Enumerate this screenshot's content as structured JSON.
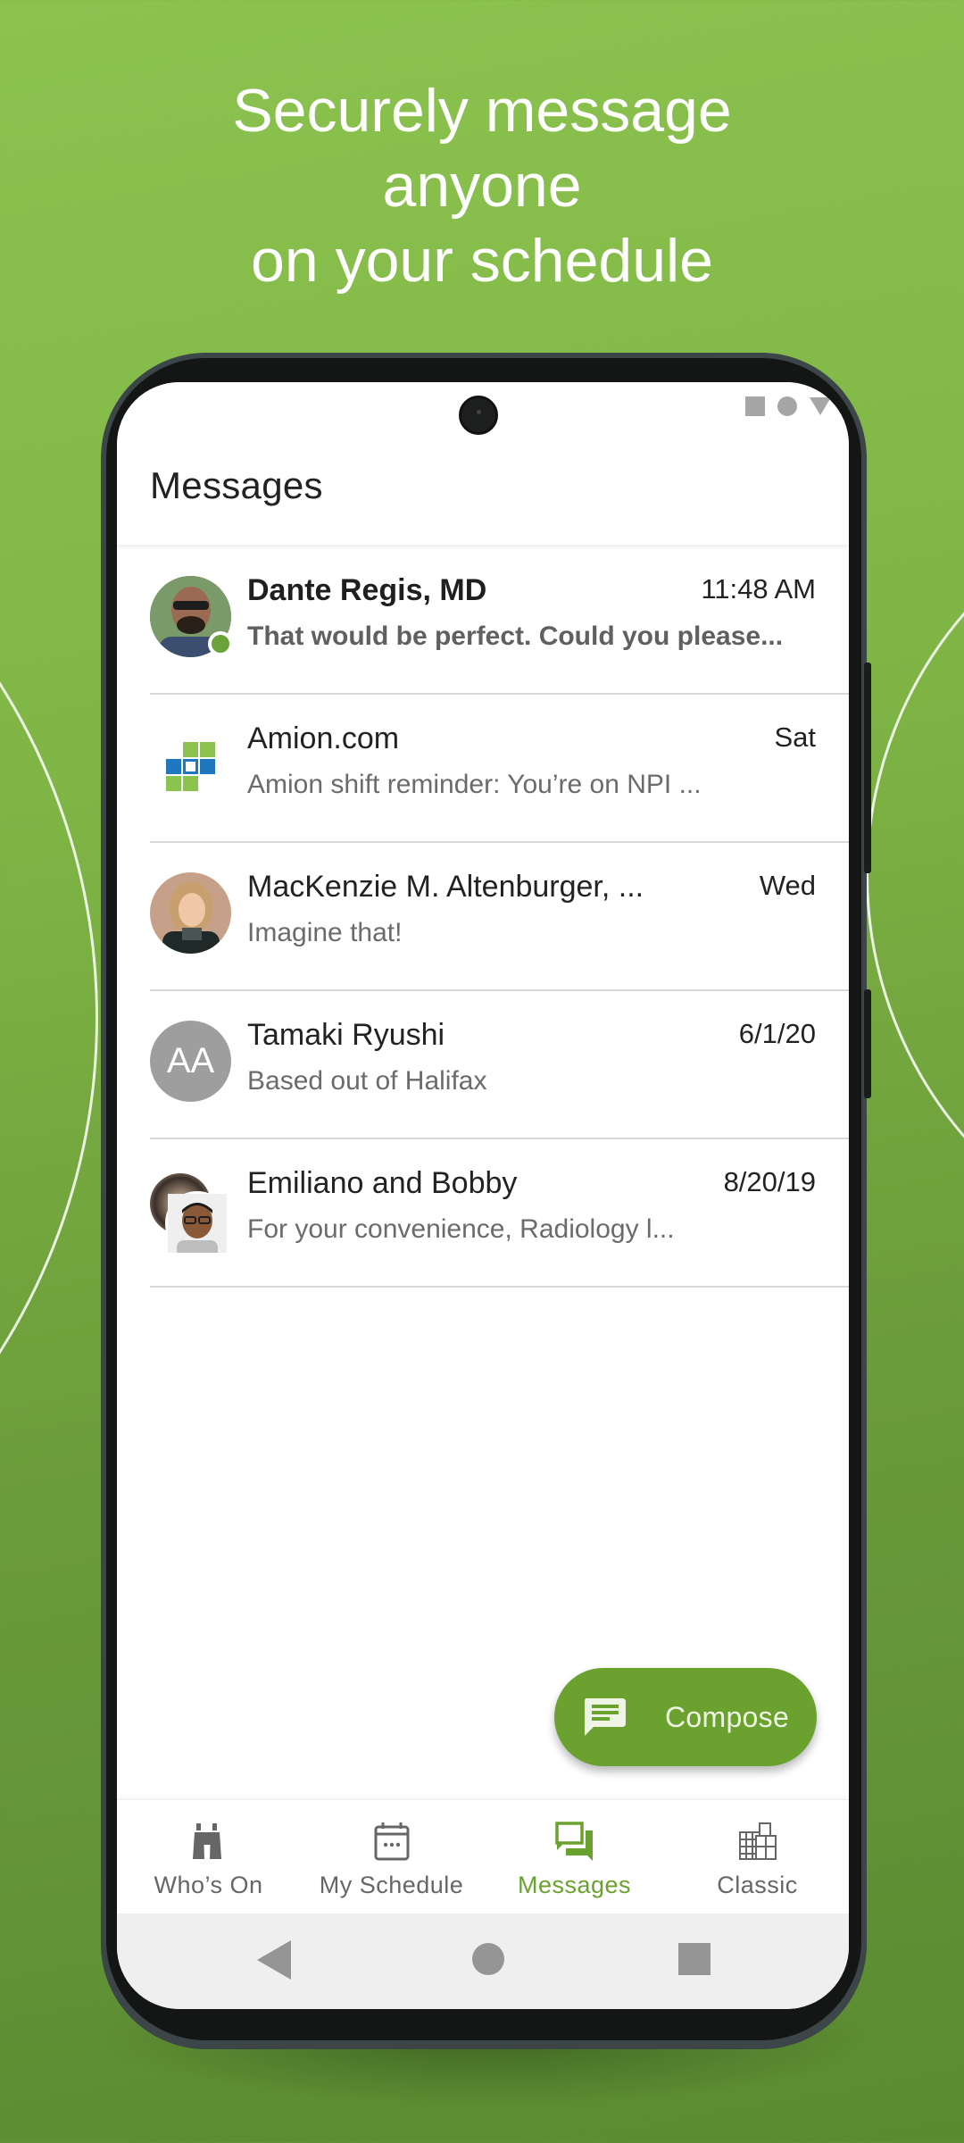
{
  "promo": {
    "headline_lines": [
      "Securely message",
      "anyone",
      "on your schedule"
    ]
  },
  "app": {
    "title": "Messages",
    "accent_color": "#6aa12f"
  },
  "conversations": [
    {
      "name": "Dante Regis, MD",
      "time": "11:48 AM",
      "preview": "That would be perfect. Could you please...",
      "unread": true,
      "online": true,
      "avatar": "photo"
    },
    {
      "name": "Amion.com",
      "time": "Sat",
      "preview": "Amion shift reminder: You’re on NPI ...",
      "unread": false,
      "avatar": "amion-logo"
    },
    {
      "name": "MacKenzie M. Altenburger, ...",
      "time": "Wed",
      "preview": "Imagine that!",
      "unread": false,
      "avatar": "photo"
    },
    {
      "name": "Tamaki Ryushi",
      "time": "6/1/20",
      "preview": "Based out of Halifax",
      "unread": false,
      "avatar": "initials",
      "initials": "AA"
    },
    {
      "name": "Emiliano and Bobby",
      "time": "8/20/19",
      "preview": "For your convenience, Radiology l...",
      "unread": false,
      "avatar": "group"
    }
  ],
  "compose": {
    "label": "Compose",
    "icon": "message-icon"
  },
  "bottom_nav": {
    "items": [
      {
        "label": "Who’s On",
        "icon": "binoculars-icon",
        "active": false
      },
      {
        "label": "My Schedule",
        "icon": "calendar-icon",
        "active": false
      },
      {
        "label": "Messages",
        "icon": "chat-icon",
        "active": true
      },
      {
        "label": "Classic",
        "icon": "grid-calendar-icon",
        "active": false
      }
    ]
  }
}
